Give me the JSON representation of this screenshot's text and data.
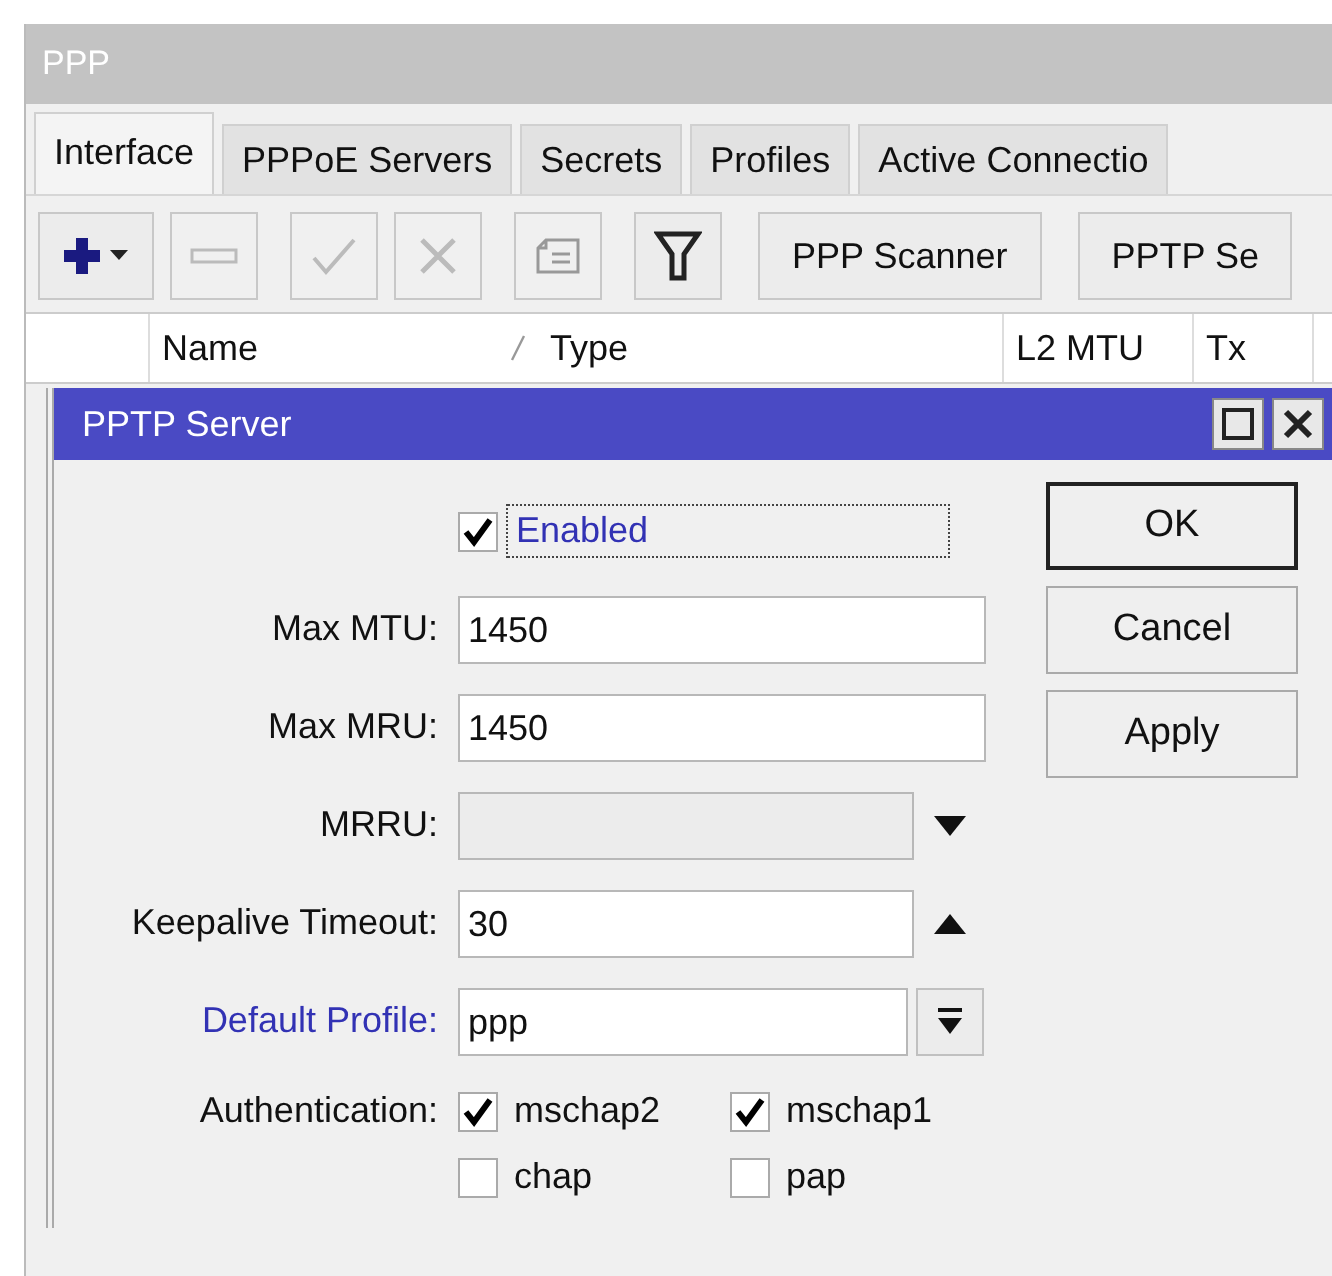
{
  "window": {
    "title": "PPP"
  },
  "tabs": [
    {
      "label": "Interface",
      "selected": true
    },
    {
      "label": "PPPoE Servers",
      "selected": false
    },
    {
      "label": "Secrets",
      "selected": false
    },
    {
      "label": "Profiles",
      "selected": false
    },
    {
      "label": "Active Connectio",
      "selected": false
    }
  ],
  "toolbar": {
    "icon_buttons": [
      {
        "kind": "add",
        "disabled": false
      },
      {
        "kind": "remove",
        "disabled": true
      },
      {
        "kind": "enable",
        "disabled": true
      },
      {
        "kind": "disable",
        "disabled": true
      },
      {
        "kind": "comment",
        "disabled": true
      },
      {
        "kind": "filter",
        "disabled": false
      }
    ],
    "text_buttons": [
      "PPP Scanner",
      "PPTP Se"
    ]
  },
  "table": {
    "columns": [
      "Name",
      "Type",
      "L2 MTU",
      "Tx"
    ]
  },
  "dialog": {
    "title": "PPTP Server",
    "enabled": {
      "label": "Enabled",
      "checked": true
    },
    "fields": [
      {
        "kind": "text",
        "label": "Max MTU:",
        "value": "1450",
        "link": false
      },
      {
        "kind": "text",
        "label": "Max MRU:",
        "value": "1450",
        "link": false
      },
      {
        "kind": "expand",
        "label": "MRRU:",
        "link": false
      },
      {
        "kind": "collapse",
        "label": "Keepalive Timeout:",
        "value": "30",
        "link": false
      },
      {
        "kind": "select",
        "label": "Default Profile:",
        "value": "ppp",
        "link": true
      }
    ],
    "authentication": {
      "label": "Authentication:",
      "options": [
        {
          "label": "mschap2",
          "checked": true
        },
        {
          "label": "mschap1",
          "checked": true
        },
        {
          "label": "chap",
          "checked": false
        },
        {
          "label": "pap",
          "checked": false
        }
      ]
    },
    "buttons": [
      {
        "label": "OK",
        "default": true
      },
      {
        "label": "Cancel",
        "default": false
      },
      {
        "label": "Apply",
        "default": false
      }
    ]
  }
}
